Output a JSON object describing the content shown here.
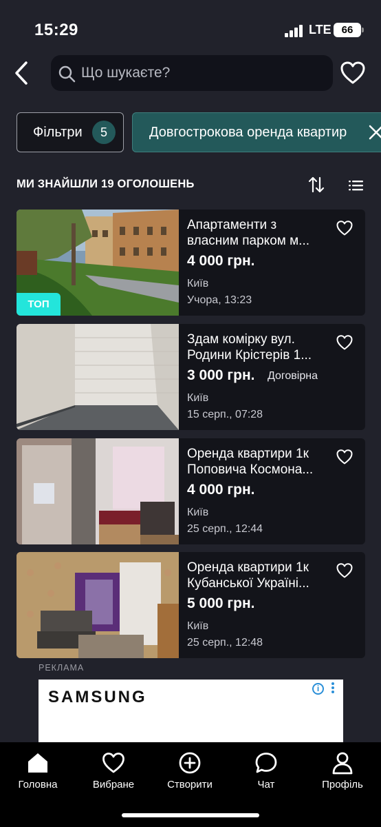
{
  "status_bar": {
    "time": "15:29",
    "network": "LTE",
    "battery": "66"
  },
  "search": {
    "placeholder": "Що шукаєте?"
  },
  "filters": {
    "label": "Фільтри",
    "count": "5",
    "active_chip": "Довгострокова оренда квартир"
  },
  "results": {
    "title": "МИ ЗНАЙШЛИ 19 ОГОЛОШЕНЬ"
  },
  "listings": [
    {
      "title_line1": "Апартаменти з",
      "title_line2": "власним парком м...",
      "price": "4 000 грн.",
      "negotiable": "",
      "city": "Київ",
      "date": "Учора, 13:23",
      "badge": "ТОП"
    },
    {
      "title_line1": "Здам комірку вул.",
      "title_line2": "Родини Крістерів 1...",
      "price": "3 000 грн.",
      "negotiable": "Договірна",
      "city": "Київ",
      "date": "15 серп., 07:28",
      "badge": ""
    },
    {
      "title_line1": "Оренда квартири 1к",
      "title_line2": "Поповича Космона...",
      "price": "4 000 грн.",
      "negotiable": "",
      "city": "Київ",
      "date": "25 серп., 12:44",
      "badge": ""
    },
    {
      "title_line1": "Оренда квартири 1к",
      "title_line2": "Кубанської Україні...",
      "price": "5 000 грн.",
      "negotiable": "",
      "city": "Київ",
      "date": "25 серп., 12:48",
      "badge": ""
    }
  ],
  "ad": {
    "label": "РЕКЛАМА",
    "brand": "SAMSUNG"
  },
  "tabbar": {
    "items": [
      {
        "label": "Головна",
        "icon": "home-icon"
      },
      {
        "label": "Вибране",
        "icon": "heart-icon"
      },
      {
        "label": "Створити",
        "icon": "plus-circle-icon"
      },
      {
        "label": "Чат",
        "icon": "chat-icon"
      },
      {
        "label": "Профіль",
        "icon": "profile-icon"
      }
    ]
  },
  "colors": {
    "background": "#21222b",
    "card": "#13141a",
    "accent_teal": "#23595a",
    "top_badge": "#23e5db"
  }
}
